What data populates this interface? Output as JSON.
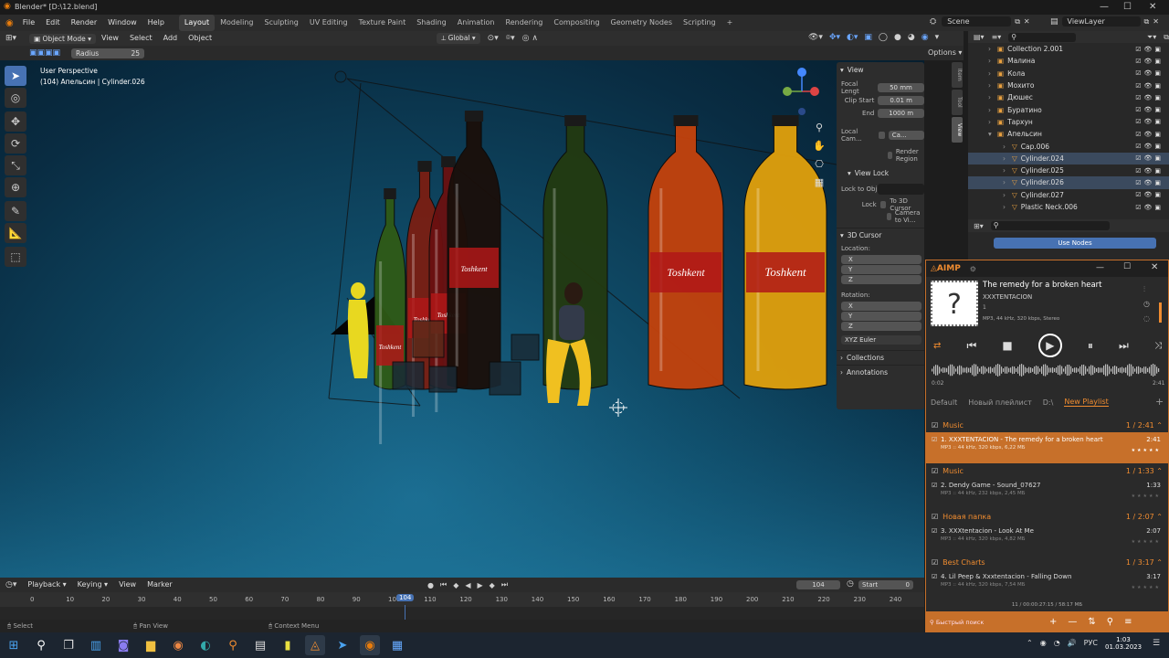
{
  "titlebar": {
    "title": "Blender* [D:\\12.blend]"
  },
  "menu": [
    "File",
    "Edit",
    "Render",
    "Window",
    "Help"
  ],
  "workspaces": [
    "Layout",
    "Modeling",
    "Sculpting",
    "UV Editing",
    "Texture Paint",
    "Shading",
    "Animation",
    "Rendering",
    "Compositing",
    "Geometry Nodes",
    "Scripting"
  ],
  "active_workspace": "Layout",
  "scene": "Scene",
  "viewlayer": "ViewLayer",
  "header": {
    "mode": "Object Mode",
    "view": "View",
    "select": "Select",
    "add": "Add",
    "object": "Object",
    "orientation": "Global"
  },
  "toolopts": {
    "radius_label": "Radius",
    "radius_value": "25",
    "options": "Options"
  },
  "viewport": {
    "line1": "User Perspective",
    "line2": "(104) Апельсин | Cylinder.026"
  },
  "npanel": {
    "tabs": [
      "Item",
      "Tool",
      "View"
    ],
    "view_title": "View",
    "focal_label": "Focal Lengt",
    "focal_value": "50 mm",
    "clipstart_label": "Clip Start",
    "clipstart_value": "0.01 m",
    "end_label": "End",
    "end_value": "1000 m",
    "localcam_label": "Local Cam...",
    "localcam_value": "Ca...",
    "render_region": "Render Region",
    "viewlock_title": "View Lock",
    "lockobj_label": "Lock to Obj",
    "lock_label": "Lock",
    "to3dcursor": "To 3D Cursor",
    "camtoview": "Camera to Vi...",
    "cursor_title": "3D Cursor",
    "location_label": "Location:",
    "rotation_label": "Rotation:",
    "x": "X",
    "y": "Y",
    "z": "Z",
    "euler": "XYZ Euler",
    "collections": "Collections",
    "annotations": "Annotations"
  },
  "outliner": {
    "rows": [
      {
        "label": "Collection 2.001",
        "sel": false
      },
      {
        "label": "Малина",
        "sel": false
      },
      {
        "label": "Кола",
        "sel": false
      },
      {
        "label": "Мохито",
        "sel": false
      },
      {
        "label": "Дюшес",
        "sel": false
      },
      {
        "label": "Буратино",
        "sel": false
      },
      {
        "label": "Тархун",
        "sel": false
      },
      {
        "label": "Апельсин",
        "sel": false
      },
      {
        "label": "Cap.006",
        "sel": false
      },
      {
        "label": "Cylinder.024",
        "sel": true
      },
      {
        "label": "Cylinder.025",
        "sel": false
      },
      {
        "label": "Cylinder.026",
        "sel": true
      },
      {
        "label": "Cylinder.027",
        "sel": false
      },
      {
        "label": "Plastic Neck.006",
        "sel": false
      }
    ]
  },
  "props": {
    "use_nodes": "Use Nodes"
  },
  "aimp": {
    "brand": "AIMP",
    "title": "The remedy for a broken heart",
    "artist": "XXXTENTACION",
    "track_no": "1",
    "format": "MP3, 44 kHz, 320 kbps, Stereo",
    "time_start": "0:02",
    "time_end": "2:41",
    "playlists": [
      "Default",
      "Новый плейлист",
      "D:\\",
      "New Playlist"
    ],
    "active_playlist": "New Playlist",
    "groups": [
      {
        "name": "Music",
        "count": "1 / 2:41",
        "track": {
          "title": "1. XXXTENTACION - The remedy for a broken heart",
          "meta": "MP3 :: 44 kHz, 320 kbps, 6,22 МБ",
          "dur": "2:41",
          "playing": true
        }
      },
      {
        "name": "Music",
        "count": "1 / 1:33",
        "track": {
          "title": "2. Dendy Game - Sound_07627",
          "meta": "MP3 :: 44 kHz, 232 kbps, 2,45 МБ",
          "dur": "1:33",
          "playing": false
        }
      },
      {
        "name": "Новая папка",
        "count": "1 / 2:07",
        "track": {
          "title": "3. XXXtentacion - Look At Me",
          "meta": "MP3 :: 44 kHz, 320 kbps, 4,82 МБ",
          "dur": "2:07",
          "playing": false
        }
      },
      {
        "name": "Best Charts",
        "count": "1 / 3:17",
        "track": {
          "title": "4. Lil Peep & Xxxtentacion - Falling Down",
          "meta": "MP3 :: 44 kHz, 320 kbps, 7,54 МБ",
          "dur": "3:17",
          "playing": false
        }
      }
    ],
    "summary": "11 / 00:00:27:15 / 58:17 МБ",
    "search_placeholder": "Быстрый поиск"
  },
  "timeline": {
    "playback": "Playback",
    "keying": "Keying",
    "view": "View",
    "marker": "Marker",
    "current_frame": "104",
    "start_label": "Start",
    "start_value": "0",
    "ticks": [
      "0",
      "10",
      "20",
      "30",
      "40",
      "50",
      "60",
      "70",
      "80",
      "90",
      "100",
      "110",
      "120",
      "130",
      "140",
      "150",
      "160",
      "170",
      "180",
      "190",
      "200",
      "210",
      "220",
      "230",
      "240"
    ]
  },
  "status": {
    "select": "Select",
    "pan": "Pan View",
    "context": "Context Menu"
  },
  "taskbar": {
    "lang": "РУС",
    "time": "1:03",
    "date": "01.03.2023"
  },
  "bottles": [
    {
      "color": "#2f5a16",
      "label": "Toshkent"
    },
    {
      "color": "#7a1e12",
      "label": "Toshkent"
    },
    {
      "color": "#6a1010",
      "label": "Toshkent"
    },
    {
      "color": "#1a0f0a",
      "label": "Toshkent"
    },
    {
      "color": "#233a10",
      "label": ""
    },
    {
      "color": "#c4420c",
      "label": "Toshkent"
    },
    {
      "color": "#e0a00c",
      "label": "Toshkent"
    }
  ]
}
